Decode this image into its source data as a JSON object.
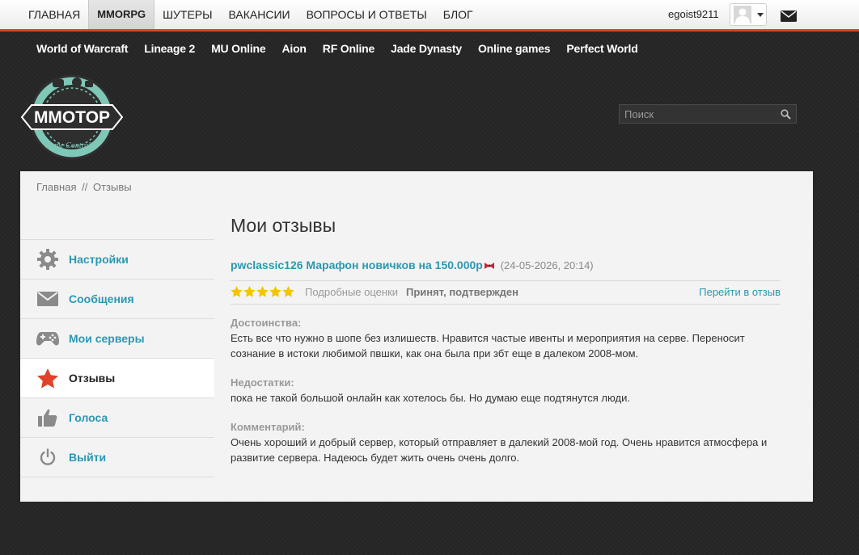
{
  "topnav": {
    "items": [
      {
        "label": "ГЛАВНАЯ"
      },
      {
        "label": "MMORPG",
        "active": true
      },
      {
        "label": "ШУТЕРЫ"
      },
      {
        "label": "ВАКАНСИИ"
      },
      {
        "label": "ВОПРОСЫ И ОТВЕТЫ"
      },
      {
        "label": "БЛОГ"
      }
    ],
    "username": "egoist9211",
    "accent_color": "#d9442b"
  },
  "gamenav": {
    "items": [
      "World of Warcraft",
      "Lineage 2",
      "MU Online",
      "Aion",
      "RF Online",
      "Jade Dynasty",
      "Online games",
      "Perfect World"
    ]
  },
  "logo": {
    "title": "MMOTOP",
    "subtitle": "Game Controller"
  },
  "search": {
    "placeholder": "Поиск",
    "icon": "search-icon"
  },
  "breadcrumb": {
    "home": "Главная",
    "separator": "//",
    "current": "Отзывы"
  },
  "sidebar": {
    "items": [
      {
        "label": "Настройки",
        "icon": "gear-icon"
      },
      {
        "label": "Сообщения",
        "icon": "envelope-icon"
      },
      {
        "label": "Мои серверы",
        "icon": "gamepad-icon"
      },
      {
        "label": "Отзывы",
        "icon": "star-icon",
        "active": true
      },
      {
        "label": "Голоса",
        "icon": "thumbs-up-icon"
      },
      {
        "label": "Выйти",
        "icon": "power-icon"
      }
    ]
  },
  "main": {
    "title": "Мои отзывы",
    "review": {
      "server_name": "pwclassic126 Марафон новичков на 150.000р",
      "date": "(24-05-2026, 20:14)",
      "rating_stars": 5,
      "detail_link": "Подробные оценки",
      "status": "Принят, подтвержден",
      "goto_link": "Перейти в отзыв",
      "sections": [
        {
          "heading": "Достоинства:",
          "text": "Есть все что нужно в шопе без излишеств. Нравится частые ивенты и мероприятия на серве. Переносит сознание в истоки любимой пвшки, как она была при збт еще в далеком 2008-мом."
        },
        {
          "heading": "Недостатки:",
          "text": "пока не такой большой онлайн как хотелось бы. Но думаю еще подтянутся люди."
        },
        {
          "heading": "Комментарий:",
          "text": "Очень хороший и добрый сервер, который отправляет в далекий 2008-мой год. Очень нравится атмосфера и развитие сервера. Надеюсь будет жить очень очень долго."
        }
      ]
    }
  },
  "colors": {
    "link": "#2a98b0",
    "star": "#f5c400",
    "active_menu_star": "#e0422a"
  }
}
